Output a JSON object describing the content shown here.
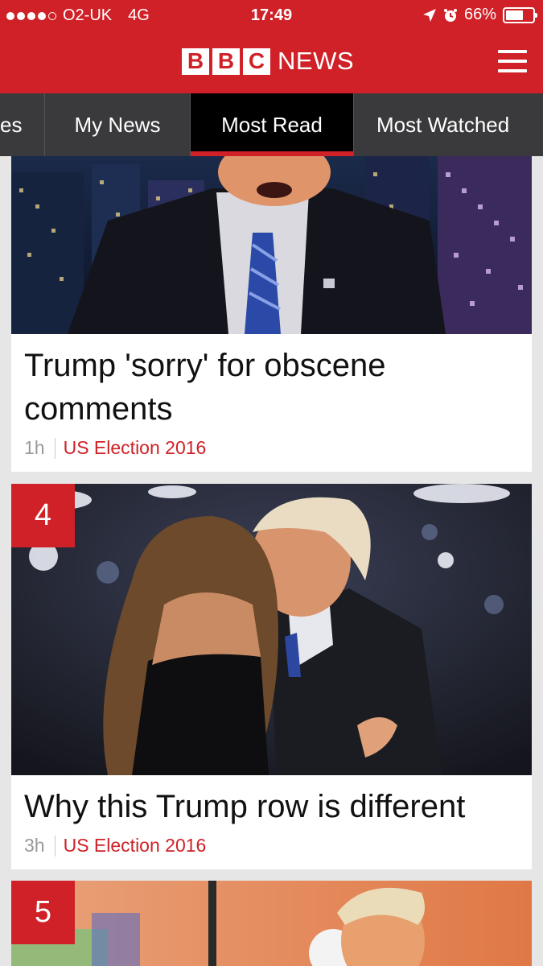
{
  "status_bar": {
    "carrier": "O2-UK",
    "network": "4G",
    "time": "17:49",
    "battery": "66%",
    "battery_level": 0.66
  },
  "header": {
    "logo_letters": [
      "B",
      "B",
      "C"
    ],
    "logo_word": "NEWS",
    "brand_color": "#cf2127"
  },
  "tabs": [
    {
      "label": "es",
      "active": false
    },
    {
      "label": "My News",
      "active": false
    },
    {
      "label": "Most Read",
      "active": true
    },
    {
      "label": "Most Watched",
      "active": false
    }
  ],
  "articles": [
    {
      "headline": "Trump 'sorry' for obscene comments",
      "age": "1h",
      "topic": "US Election 2016",
      "rank": ""
    },
    {
      "headline": "Why this Trump row is different",
      "age": "3h",
      "topic": "US Election 2016",
      "rank": "4"
    },
    {
      "rank": "5"
    }
  ]
}
